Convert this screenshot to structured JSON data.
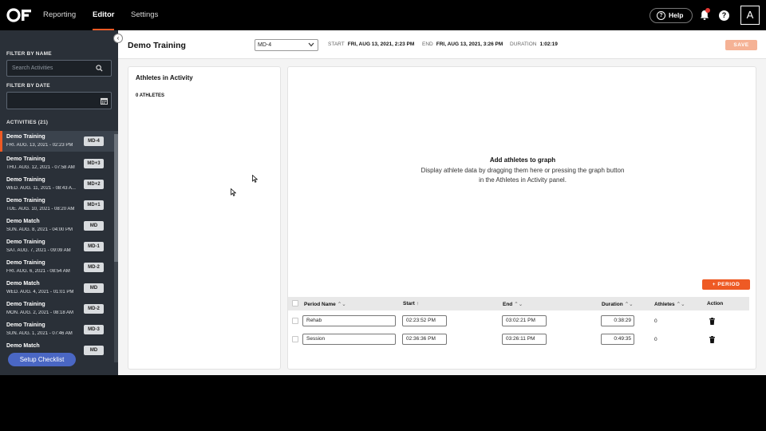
{
  "nav": {
    "items": [
      {
        "label": "Reporting",
        "active": false
      },
      {
        "label": "Editor",
        "active": true
      },
      {
        "label": "Settings",
        "active": false
      }
    ],
    "help_label": "Help",
    "avatar_initial": "A",
    "accent_color": "#ee5a24"
  },
  "sidebar": {
    "filter_by_name_label": "FILTER BY NAME",
    "search_placeholder": "Search Activities",
    "filter_by_date_label": "FILTER BY DATE",
    "activities_label": "ACTIVITIES (21)",
    "activities": [
      {
        "name": "Demo Training",
        "date": "FRI. AUG. 13, 2021 - 02:23 PM",
        "badge": "MD-4",
        "selected": true
      },
      {
        "name": "Demo Training",
        "date": "THU. AUG. 12, 2021 - 07:58 AM",
        "badge": "MD+3",
        "selected": false
      },
      {
        "name": "Demo Training",
        "date": "WED. AUG. 11, 2021 - 08:43 A...",
        "badge": "MD+2",
        "selected": false
      },
      {
        "name": "Demo Training",
        "date": "TUE. AUG. 10, 2021 - 08:20 AM",
        "badge": "MD+1",
        "selected": false
      },
      {
        "name": "Demo Match",
        "date": "SUN. AUG. 8, 2021 - 04:00 PM",
        "badge": "MD",
        "selected": false
      },
      {
        "name": "Demo Training",
        "date": "SAT. AUG. 7, 2021 - 09:09 AM",
        "badge": "MD-1",
        "selected": false
      },
      {
        "name": "Demo Training",
        "date": "FRI. AUG. 6, 2021 - 08:54 AM",
        "badge": "MD-2",
        "selected": false
      },
      {
        "name": "Demo Match",
        "date": "WED. AUG. 4, 2021 - 01:01 PM",
        "badge": "MD",
        "selected": false
      },
      {
        "name": "Demo Training",
        "date": "MON. AUG. 2, 2021 - 08:18 AM",
        "badge": "MD-2",
        "selected": false
      },
      {
        "name": "Demo Training",
        "date": "SUN. AUG. 1, 2021 - 07:46 AM",
        "badge": "MD-3",
        "selected": false
      },
      {
        "name": "Demo Match",
        "date": "",
        "badge": "MD",
        "selected": false
      }
    ],
    "setup_checklist_label": "Setup Checklist"
  },
  "header": {
    "title": "Demo Training",
    "md_select_value": "MD-4",
    "start_label": "START",
    "start_value": "FRI, AUG 13, 2021, 2:23 PM",
    "end_label": "END",
    "end_value": "FRI, AUG 13, 2021, 3:26 PM",
    "duration_label": "DURATION",
    "duration_value": "1:02:19",
    "save_label": "SAVE"
  },
  "athletes_panel": {
    "title": "Athletes in Activity",
    "count_label": "0 ATHLETES"
  },
  "graph_panel": {
    "empty_title": "Add athletes to graph",
    "empty_desc": "Display athlete data by dragging them here or pressing the graph button in the Athletes in Activity panel.",
    "add_period_label": "PERIOD"
  },
  "periods_table": {
    "columns": {
      "period_name": "Period Name",
      "start": "Start",
      "end": "End",
      "duration": "Duration",
      "athletes": "Athletes",
      "action": "Action"
    },
    "rows": [
      {
        "name": "Rehab",
        "start": "02:23:52 PM",
        "end": "03:02:21 PM",
        "duration": "0:38:29",
        "athletes": "0"
      },
      {
        "name": "Session",
        "start": "02:36:36 PM",
        "end": "03:26:11 PM",
        "duration": "0:49:35",
        "athletes": "0"
      }
    ]
  }
}
